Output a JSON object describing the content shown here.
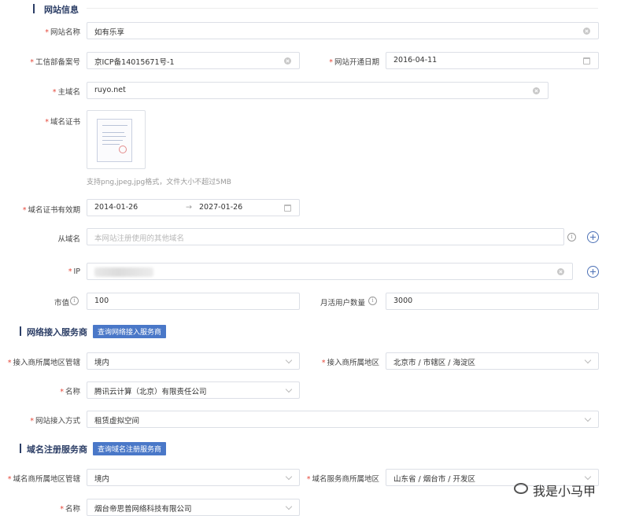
{
  "sections": {
    "website_info": "网站信息",
    "network_provider": "网络接入服务商",
    "domain_registrar": "域名注册服务商"
  },
  "buttons": {
    "query_network_provider": "查询网络接入服务商",
    "query_domain_registrar": "查询域名注册服务商"
  },
  "fields": {
    "site_name": {
      "label": "网站名称",
      "value": "如有乐享"
    },
    "icp_number": {
      "label": "工信部备案号",
      "value": "京ICP备14015671号-1"
    },
    "open_date": {
      "label": "网站开通日期",
      "value": "2016-04-11"
    },
    "main_domain": {
      "label": "主域名",
      "value": "ruyo.net"
    },
    "domain_cert": {
      "label": "域名证书",
      "hint": "支持png,jpeg,jpg格式，文件大小不超过5MB"
    },
    "cert_validity": {
      "label": "域名证书有效期",
      "start": "2014-01-26",
      "separator": "→",
      "end": "2027-01-26"
    },
    "sub_domain": {
      "label": "从域名",
      "placeholder": "本网站注册使用的其他域名"
    },
    "ip": {
      "label": "IP"
    },
    "market_value": {
      "label": "市值",
      "value": "100"
    },
    "monthly_active": {
      "label": "月活用户数量",
      "value": "3000"
    },
    "access_region_admin": {
      "label": "接入商所属地区管辖",
      "value": "境内"
    },
    "access_region": {
      "label": "接入商所属地区",
      "value": "北京市 / 市辖区 / 海淀区"
    },
    "access_name": {
      "label": "名称",
      "value": "腾讯云计算（北京）有限责任公司"
    },
    "access_method": {
      "label": "网站接入方式",
      "value": "租赁虚拟空间"
    },
    "registrar_region_admin": {
      "label": "域名商所属地区管辖",
      "value": "境内"
    },
    "registrar_region": {
      "label": "域名服务商所属地区",
      "value": "山东省 / 烟台市 / 开发区"
    },
    "registrar_name": {
      "label": "名称",
      "value": "烟台帝思普网络科技有限公司"
    }
  },
  "watermark": "我是小马甲",
  "required_mark": "*",
  "info_glyph": "i",
  "colors": {
    "accent": "#4a78c8",
    "section": "#2c3e66",
    "required": "#e5483a"
  }
}
